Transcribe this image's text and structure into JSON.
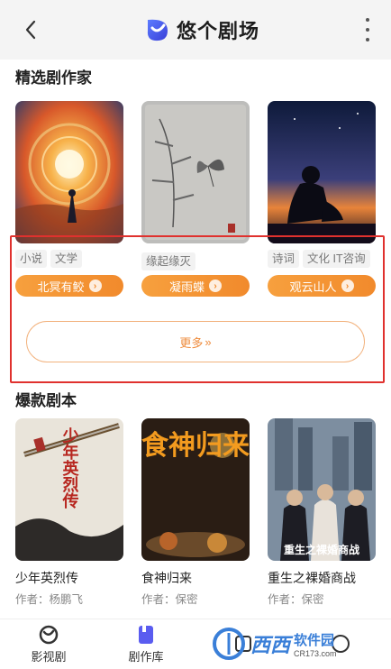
{
  "header": {
    "title": "悠个剧场",
    "back_icon": "chevron-left-icon",
    "menu_icon": "more-vertical-icon",
    "brand_color": "#4b5bf0"
  },
  "featured_writers": {
    "title": "精选剧作家",
    "cards": [
      {
        "tags": [
          "小说",
          "文学"
        ],
        "author": "北冥有鲛",
        "image": "sunset-vortex-painting"
      },
      {
        "tags": [
          "缘起缘灭"
        ],
        "author": "凝雨蝶",
        "image": "butterfly-bamboo-ink"
      },
      {
        "tags": [
          "诗词",
          "文化 IT咨询"
        ],
        "author": "观云山人",
        "image": "silhouette-sunset"
      }
    ],
    "more_label": "更多",
    "accent_color": "#f18a2c"
  },
  "hot_dramas": {
    "title": "爆款剧本",
    "cards": [
      {
        "title": "少年英烈传",
        "author": "作者：杨鹏飞",
        "image": "sword-calligraphy-poster",
        "poster_text": "少年英烈传"
      },
      {
        "title": "食神归来",
        "author": "作者：保密",
        "image": "chef-food-poster",
        "poster_text": "食神归来"
      },
      {
        "title": "重生之裸婚商战",
        "author": "作者：保密",
        "image": "business-people-poster",
        "poster_text": "重生之裸婚商战"
      }
    ]
  },
  "bottom_nav": {
    "items": [
      {
        "label": "影视剧",
        "icon": "film-reel-icon"
      },
      {
        "label": "剧作库",
        "icon": "bookmark-icon"
      },
      {
        "label": "",
        "icon": "library-icon"
      },
      {
        "label": "",
        "icon": "profile-icon"
      }
    ]
  },
  "watermark": {
    "main": "西西",
    "side_top": "软件园",
    "side_bottom": "CR173.com"
  }
}
